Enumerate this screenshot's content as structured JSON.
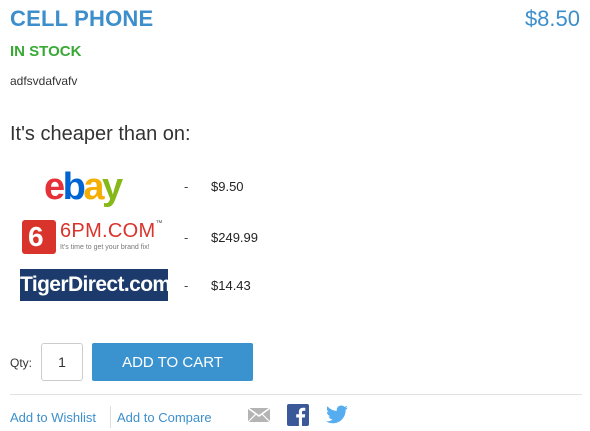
{
  "product": {
    "title": "CELL PHONE",
    "price": "$8.50",
    "stock": "IN STOCK",
    "description": "adfsvdafvafv"
  },
  "comparison": {
    "heading": "It's cheaper than on:",
    "retailers": [
      {
        "name": "ebay",
        "logo_text": [
          "e",
          "b",
          "a",
          "y"
        ],
        "price": "$9.50",
        "separator": "-"
      },
      {
        "name": "6PM.COM",
        "logo_mark": "6",
        "tagline": "It's time to get your brand fix!",
        "price": "$249.99",
        "separator": "-"
      },
      {
        "name": "TigerDirect.com",
        "logo_text": "TigerDirect.com",
        "price": "$14.43",
        "separator": "-"
      }
    ]
  },
  "cart": {
    "qty_label": "Qty:",
    "qty_value": "1",
    "add_label": "ADD TO CART"
  },
  "links": {
    "wishlist": "Add to Wishlist",
    "compare": "Add to Compare"
  },
  "colors": {
    "accent": "#3d8fcc",
    "stock": "#39a935",
    "button": "#3a92cf",
    "ebay_e": "#e53238",
    "ebay_b": "#0064d2",
    "ebay_a": "#f5af02",
    "ebay_y": "#86b817",
    "sixpm": "#d9342b",
    "tiger": "#1c3a6b",
    "facebook": "#3b5998",
    "twitter": "#55acee"
  },
  "icons": [
    "mail-icon",
    "facebook-icon",
    "twitter-icon"
  ]
}
